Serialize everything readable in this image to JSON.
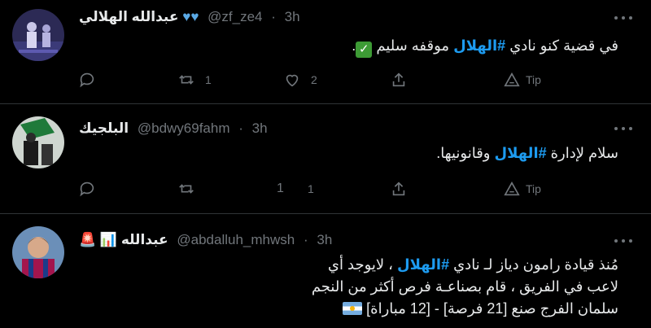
{
  "tweets": [
    {
      "name": "عبدالله الهلالي",
      "handle": "@zf_ze4",
      "time": "3h",
      "body_before": "في قضية كنو نادي ",
      "hashtag": "#الهلال",
      "body_after": " موقفه سليم",
      "retweets": "1",
      "likes": "2",
      "tip_label": "Tip"
    },
    {
      "name": "البلجيك",
      "handle": "@bdwy69fahm",
      "time": "3h",
      "body_before": "سلام لإدارة ",
      "hashtag": "#الهلال",
      "body_after": "  وقانونيها.",
      "replies": "1",
      "likes": "1",
      "tip_label": "Tip"
    },
    {
      "name": "عبدالله",
      "handle": "@abdalluh_mhwsh",
      "time": "3h",
      "line1_before": "مُنذ قيادة رامون دياز لـ نادي ",
      "hashtag": "#الهلال",
      "line1_after": " ، لايوجد أي",
      "line2": "لاعب في الفريق ، قام بصناعـة فرص أكثر من النجم",
      "line3": "سلمان الفرج صنع [21 فرصة] - [12 مباراة]"
    }
  ],
  "colors": {
    "accent": "#1d9bf0",
    "muted": "#71767b",
    "divider": "#2f3336"
  }
}
